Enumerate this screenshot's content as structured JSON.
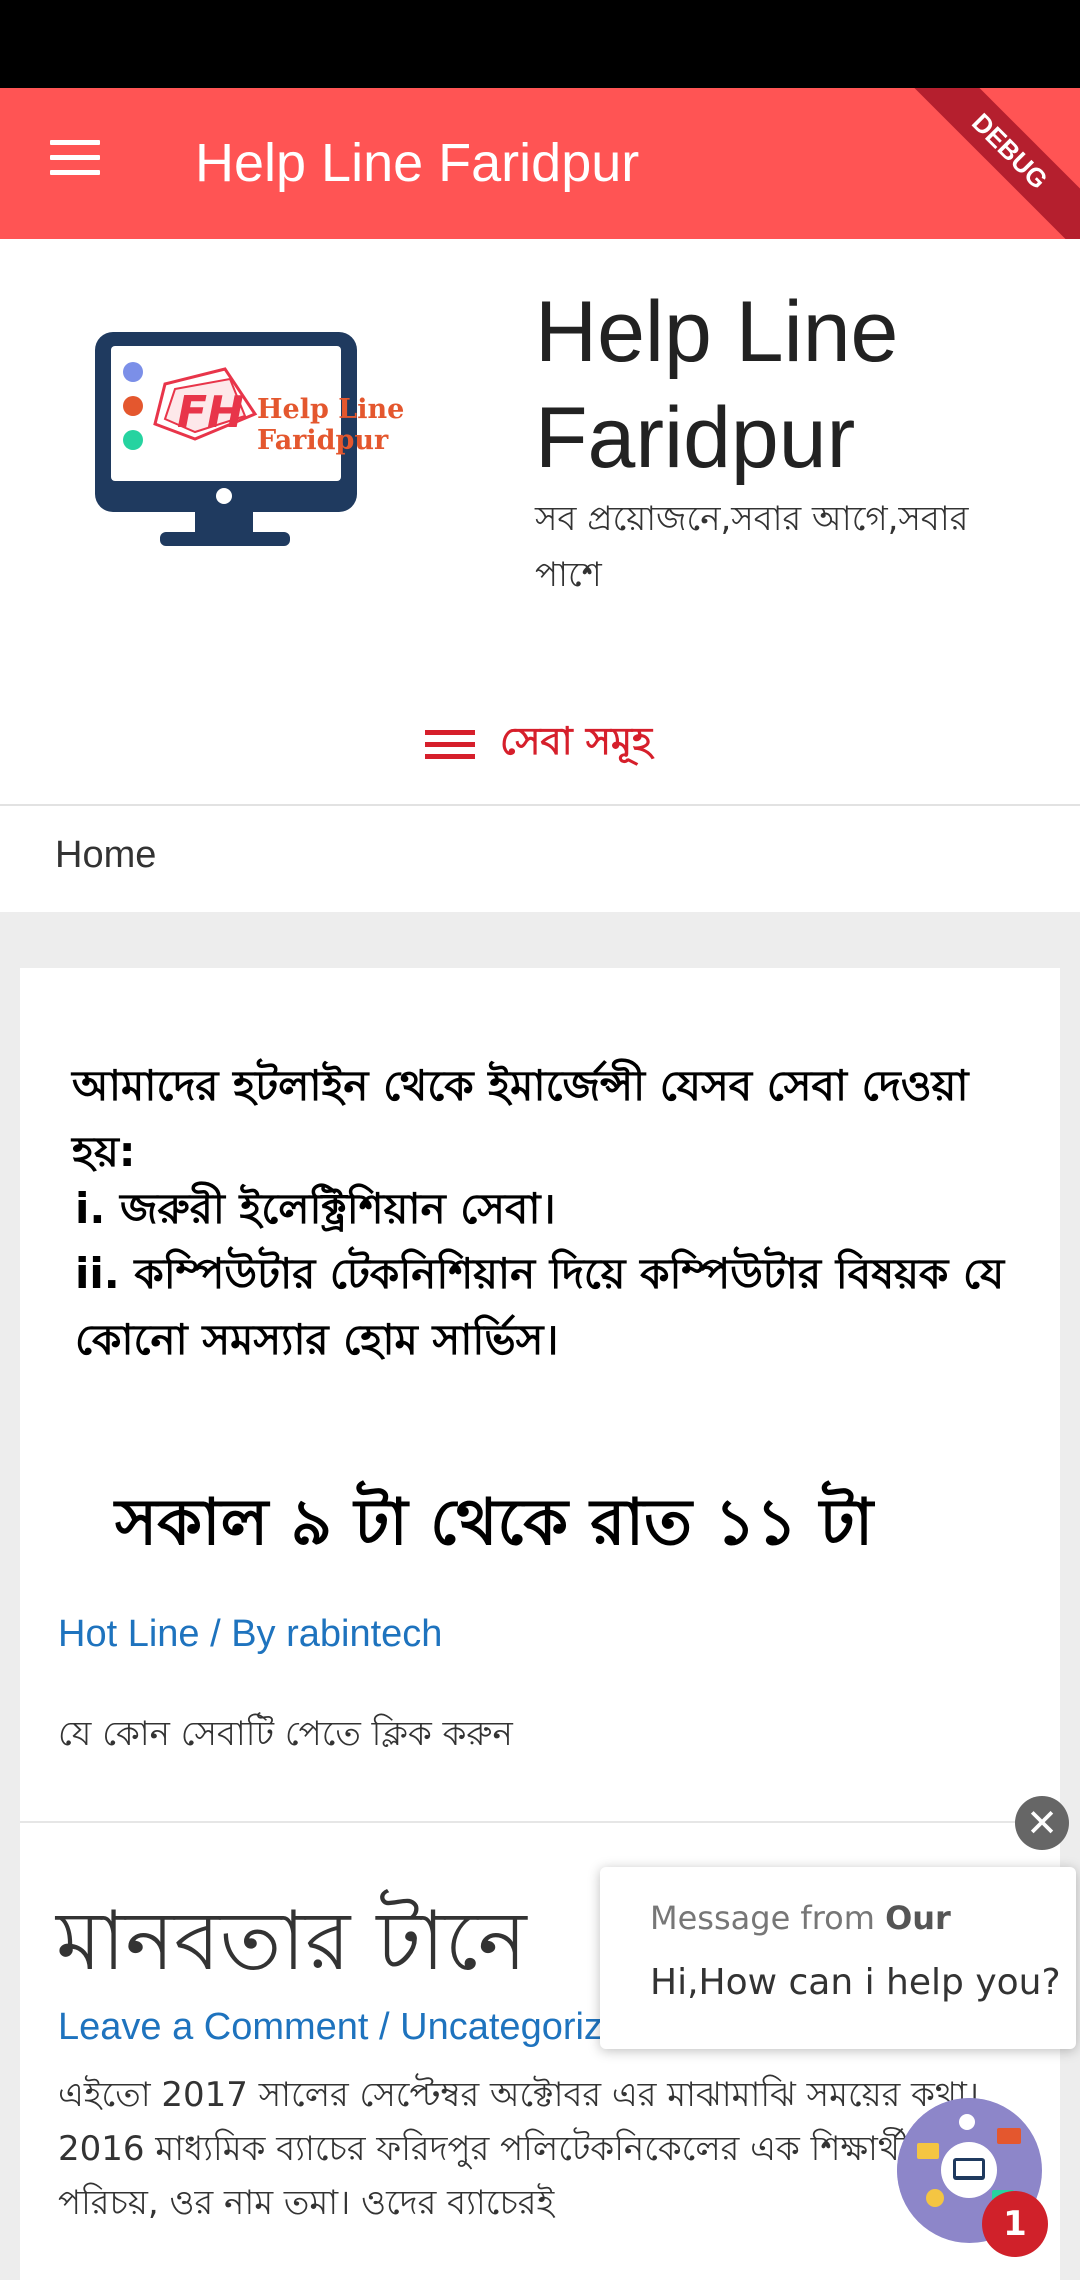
{
  "app_bar": {
    "title": "Help Line Faridpur",
    "debug_label": "DEBUG",
    "menu_icon": "hamburger-menu-icon",
    "color": "#ff5454"
  },
  "header": {
    "logo_text": "Help Line Faridpur",
    "logo_monogram": "FH",
    "site_title": "Help Line Faridpur",
    "tagline": "সব প্রয়োজনে,সবার আগে,সবার পাশে",
    "menu_label": "সেবা সমূহ"
  },
  "breadcrumb": {
    "home": "Home"
  },
  "post1": {
    "graphic_heading": "আমাদের হটলাইন থেকে ইমার্জেন্সী যেসব সেবা দেওয়া হয়:",
    "item1": "i. জরুরী ইলেক্ট্রিশিয়ান সেবা।",
    "item2": "ii. কম্পিউটার টেকনিশিয়ান দিয়ে কম্পিউটার বিষয়ক যে কোনো সমস্যার হোম সার্ভিস।",
    "hours": "সকাল ৯ টা থেকে রাত ১১ টা",
    "meta": "Hot Line / By rabintech",
    "excerpt": "যে কোন সেবাটি পেতে ক্লিক করুন"
  },
  "post2": {
    "title": "মানবতার টানে",
    "meta": "Leave a Comment / Uncategorized / By",
    "body": "এইতো 2017 সালের সেপ্টেম্বর অক্টোবর এর মাঝামাঝি সময়ের কথা। 2016 মাধ্যমিক ব্যাচের ফরিদপুর পলিটেকনিকেলের এক শিক্ষার্থীর সাথে পরিচয়, ওর নাম তমা। ওদের ব্যাচেরই"
  },
  "chat": {
    "close_label": "✕",
    "from_prefix": "Message from",
    "from_name": "Our",
    "message": "Hi,How can i help you?",
    "badge_count": "1"
  },
  "colors": {
    "accent": "#d61f2b",
    "link": "#1e73be",
    "logo_blue": "#1f3a5f"
  }
}
